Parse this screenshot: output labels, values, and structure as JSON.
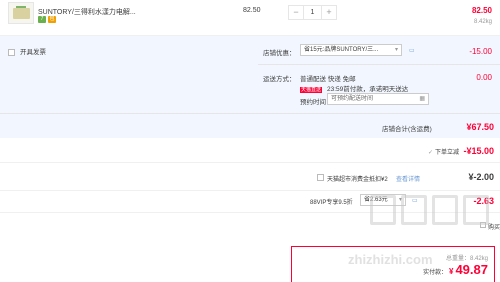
{
  "product": {
    "name": "SUNTORY/三得利水漾力电解...",
    "unit_price": "82.50",
    "quantity": "1",
    "qty_minus": "−",
    "qty_plus": "+",
    "subtotal": "82.50",
    "weight": "8.42kg",
    "tags": [
      {
        "label": "7",
        "color": "#6ab04c"
      },
      {
        "label": "包",
        "color": "#f0a000"
      }
    ]
  },
  "invoice": {
    "label": "开具发票"
  },
  "shop_promo": {
    "label": "店铺优惠：",
    "selected": "省15元:品牌SUNTORY/三...",
    "amount": "-15.00"
  },
  "shipping": {
    "label": "运送方式：",
    "method_text": "普通配送 快递 免邮",
    "amount": "0.00",
    "badge": "天猫直送",
    "note": "23:59前付款，承诺明天送达",
    "time_label": "预约时间",
    "time_placeholder": "可预约配送时间"
  },
  "shop_total": {
    "label": "店铺合计(含运费)",
    "value": "¥67.50"
  },
  "discount_row": {
    "label": "下单立减",
    "value": "-¥15.00"
  },
  "supermarket": {
    "label": "天猫超市消费金抵扣¥2",
    "link": "查看详情",
    "value": "¥-2.00"
  },
  "vip": {
    "label": "88VIP专享9.5折",
    "selected": "省2.63元",
    "value": "-2.63"
  },
  "final": {
    "checkout": "购买",
    "weight_label": "总重量：",
    "weight": "8.42kg",
    "pay_label": "实付款：",
    "currency": "¥",
    "value": "49.87"
  },
  "watermark": {
    "text": "zhizhizhi.com"
  },
  "colors": {
    "accent": "#ff0036",
    "panel_bg": "#f2f7ff",
    "link": "#6c9ad6"
  }
}
